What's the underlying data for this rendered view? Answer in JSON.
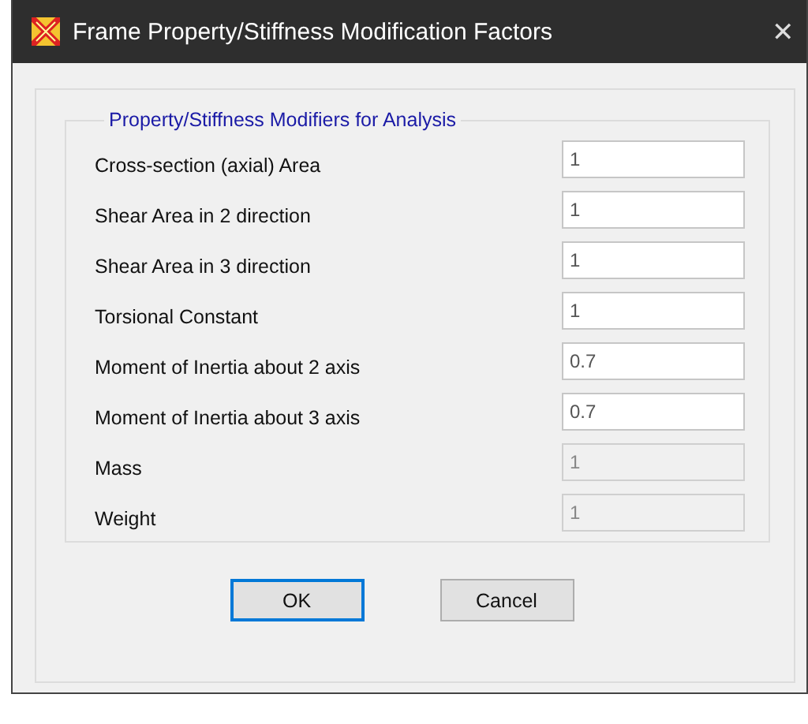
{
  "window": {
    "title": "Frame Property/Stiffness Modification Factors",
    "close": "✕"
  },
  "group": {
    "title": "Property/Stiffness Modifiers for Analysis",
    "rows": [
      {
        "label": "Cross-section (axial) Area",
        "value": "1",
        "disabled": false
      },
      {
        "label": "Shear Area in 2 direction",
        "value": "1",
        "disabled": false
      },
      {
        "label": "Shear Area in 3 direction",
        "value": "1",
        "disabled": false
      },
      {
        "label": "Torsional Constant",
        "value": "1",
        "disabled": false
      },
      {
        "label": "Moment of Inertia about 2 axis",
        "value": "0.7",
        "disabled": false
      },
      {
        "label": "Moment of Inertia about 3 axis",
        "value": "0.7",
        "disabled": false
      },
      {
        "label": "Mass",
        "value": "1",
        "disabled": true
      },
      {
        "label": "Weight",
        "value": "1",
        "disabled": true
      }
    ]
  },
  "buttons": [
    {
      "label": "OK",
      "focused": true
    },
    {
      "label": "Cancel",
      "focused": false
    }
  ]
}
